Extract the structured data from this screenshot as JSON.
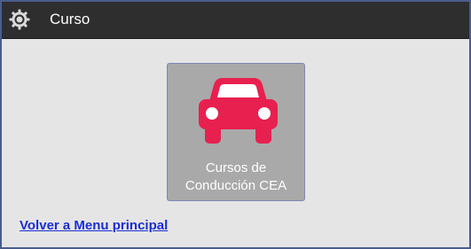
{
  "header": {
    "title": "Curso",
    "icon": "gear-icon",
    "background": "#2e2e2e"
  },
  "tiles": [
    {
      "label": "Cursos de\nConducción CEA",
      "icon": "car-icon",
      "icon_color": "#e8204f",
      "background": "#a9a9a9"
    }
  ],
  "links": {
    "back": "Volver a Menu principal",
    "color": "#1b2fd0"
  }
}
